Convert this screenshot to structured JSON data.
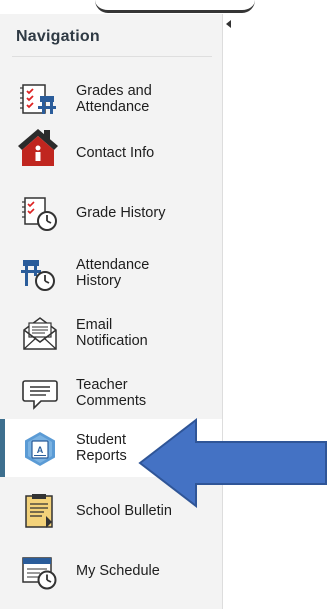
{
  "nav": {
    "title": "Navigation",
    "items": [
      {
        "label": "Grades and\nAttendance",
        "icon": "grades-attendance-icon"
      },
      {
        "label": "Contact Info",
        "icon": "contact-house-icon"
      },
      {
        "label": "Grade History",
        "icon": "grade-history-icon"
      },
      {
        "label": "Attendance\nHistory",
        "icon": "attendance-history-icon"
      },
      {
        "label": "Email\nNotification",
        "icon": "email-envelope-icon"
      },
      {
        "label": "Teacher\nComments",
        "icon": "speech-bubble-icon"
      },
      {
        "label": "Student\nReports",
        "icon": "student-reports-icon",
        "active": true
      },
      {
        "label": "School Bulletin",
        "icon": "bulletin-icon"
      },
      {
        "label": "My Schedule",
        "icon": "schedule-calendar-icon"
      }
    ]
  },
  "colors": {
    "sidebar_bg": "#f3f3f3",
    "active_bar": "#3d6f8e",
    "arrow_fill": "#4472c4",
    "arrow_stroke": "#2f5597"
  }
}
